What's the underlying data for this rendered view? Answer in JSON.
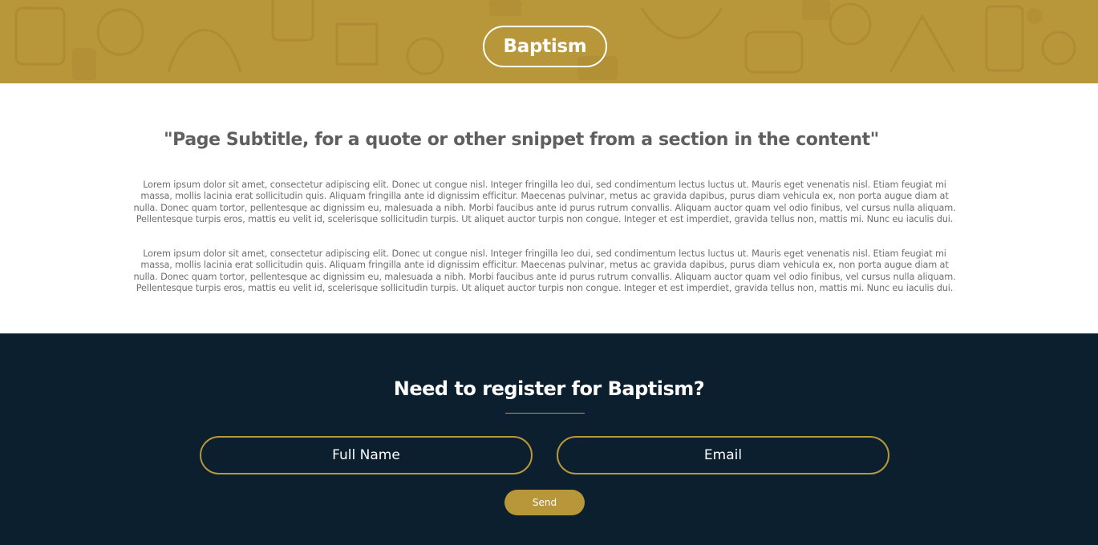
{
  "colors": {
    "accent": "#b8963a",
    "footer_background": "#0b1f2e",
    "text_gray": "#6f6f6f"
  },
  "hero": {
    "title": "Baptism"
  },
  "content": {
    "subtitle": "\"Page Subtitle, for a quote or other snippet from a section in the content\"",
    "paragraphs": [
      "Lorem ipsum dolor sit amet, consectetur adipiscing elit. Donec ut congue nisl. Integer fringilla leo dui, sed condimentum lectus luctus ut. Mauris eget venenatis nisl. Etiam feugiat mi massa, mollis lacinia erat sollicitudin quis. Aliquam fringilla ante id dignissim efficitur. Maecenas pulvinar, metus ac gravida dapibus, purus diam vehicula ex, non porta augue diam at nulla. Donec quam tortor, pellentesque ac dignissim eu, malesuada a nibh. Morbi faucibus ante id purus rutrum convallis. Aliquam auctor quam vel odio finibus, vel cursus nulla aliquam. Pellentesque turpis eros, mattis eu velit id, scelerisque sollicitudin turpis. Ut aliquet auctor turpis non congue. Integer et est imperdiet, gravida tellus non, mattis mi. Nunc eu iaculis dui.",
      "Lorem ipsum dolor sit amet, consectetur adipiscing elit. Donec ut congue nisl. Integer fringilla leo dui, sed condimentum lectus luctus ut. Mauris eget venenatis nisl. Etiam feugiat mi massa, mollis lacinia erat sollicitudin quis. Aliquam fringilla ante id dignissim efficitur. Maecenas pulvinar, metus ac gravida dapibus, purus diam vehicula ex, non porta augue diam at nulla. Donec quam tortor, pellentesque ac dignissim eu, malesuada a nibh. Morbi faucibus ante id purus rutrum convallis. Aliquam auctor quam vel odio finibus, vel cursus nulla aliquam. Pellentesque turpis eros, mattis eu velit id, scelerisque sollicitudin turpis. Ut aliquet auctor turpis non congue. Integer et est imperdiet, gravida tellus non, mattis mi. Nunc eu iaculis dui."
    ]
  },
  "register": {
    "title": "Need to register for Baptism?",
    "full_name_placeholder": "Full Name",
    "email_placeholder": "Email",
    "send_label": "Send"
  }
}
